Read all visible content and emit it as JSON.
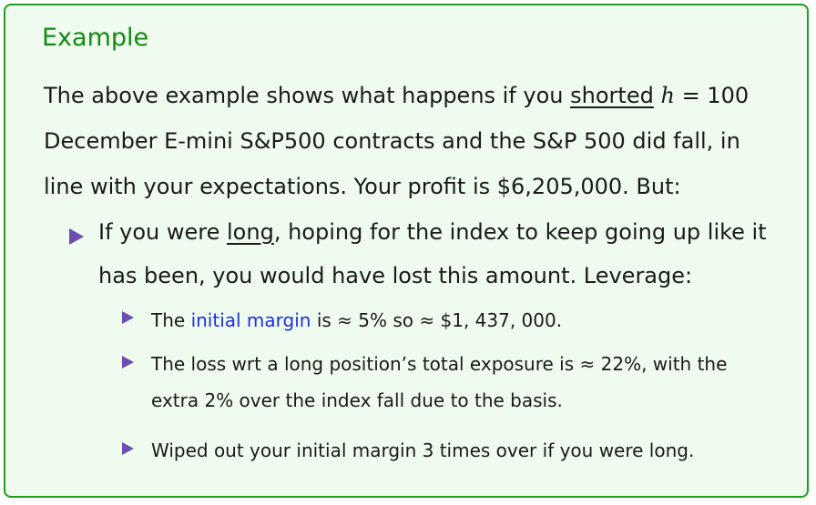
{
  "block": {
    "title": "Example",
    "intro": {
      "p1": "The above example shows what happens if you ",
      "shorted": "shorted",
      "var": "h",
      "p2": " = 100 December E-mini S&P500 contracts and the S&P 500 did fall, in line with your expectations. Your profit is $6,205,000. But:"
    },
    "bullet1": {
      "p1": "If you were ",
      "long": "long",
      "p2": ", hoping for the index to keep going up like it has been, you would have lost this amount. Leverage:"
    },
    "sub": {
      "item1_pre": "The ",
      "item1_link": "initial margin",
      "item1_post": " is ≈ 5% so ≈ $1, 437, 000.",
      "item2": "The loss wrt a long position’s total exposure is ≈ 22%, with the extra 2% over the index fall due to the basis.",
      "item3": "Wiped out your initial margin 3 times over if you were long."
    }
  }
}
